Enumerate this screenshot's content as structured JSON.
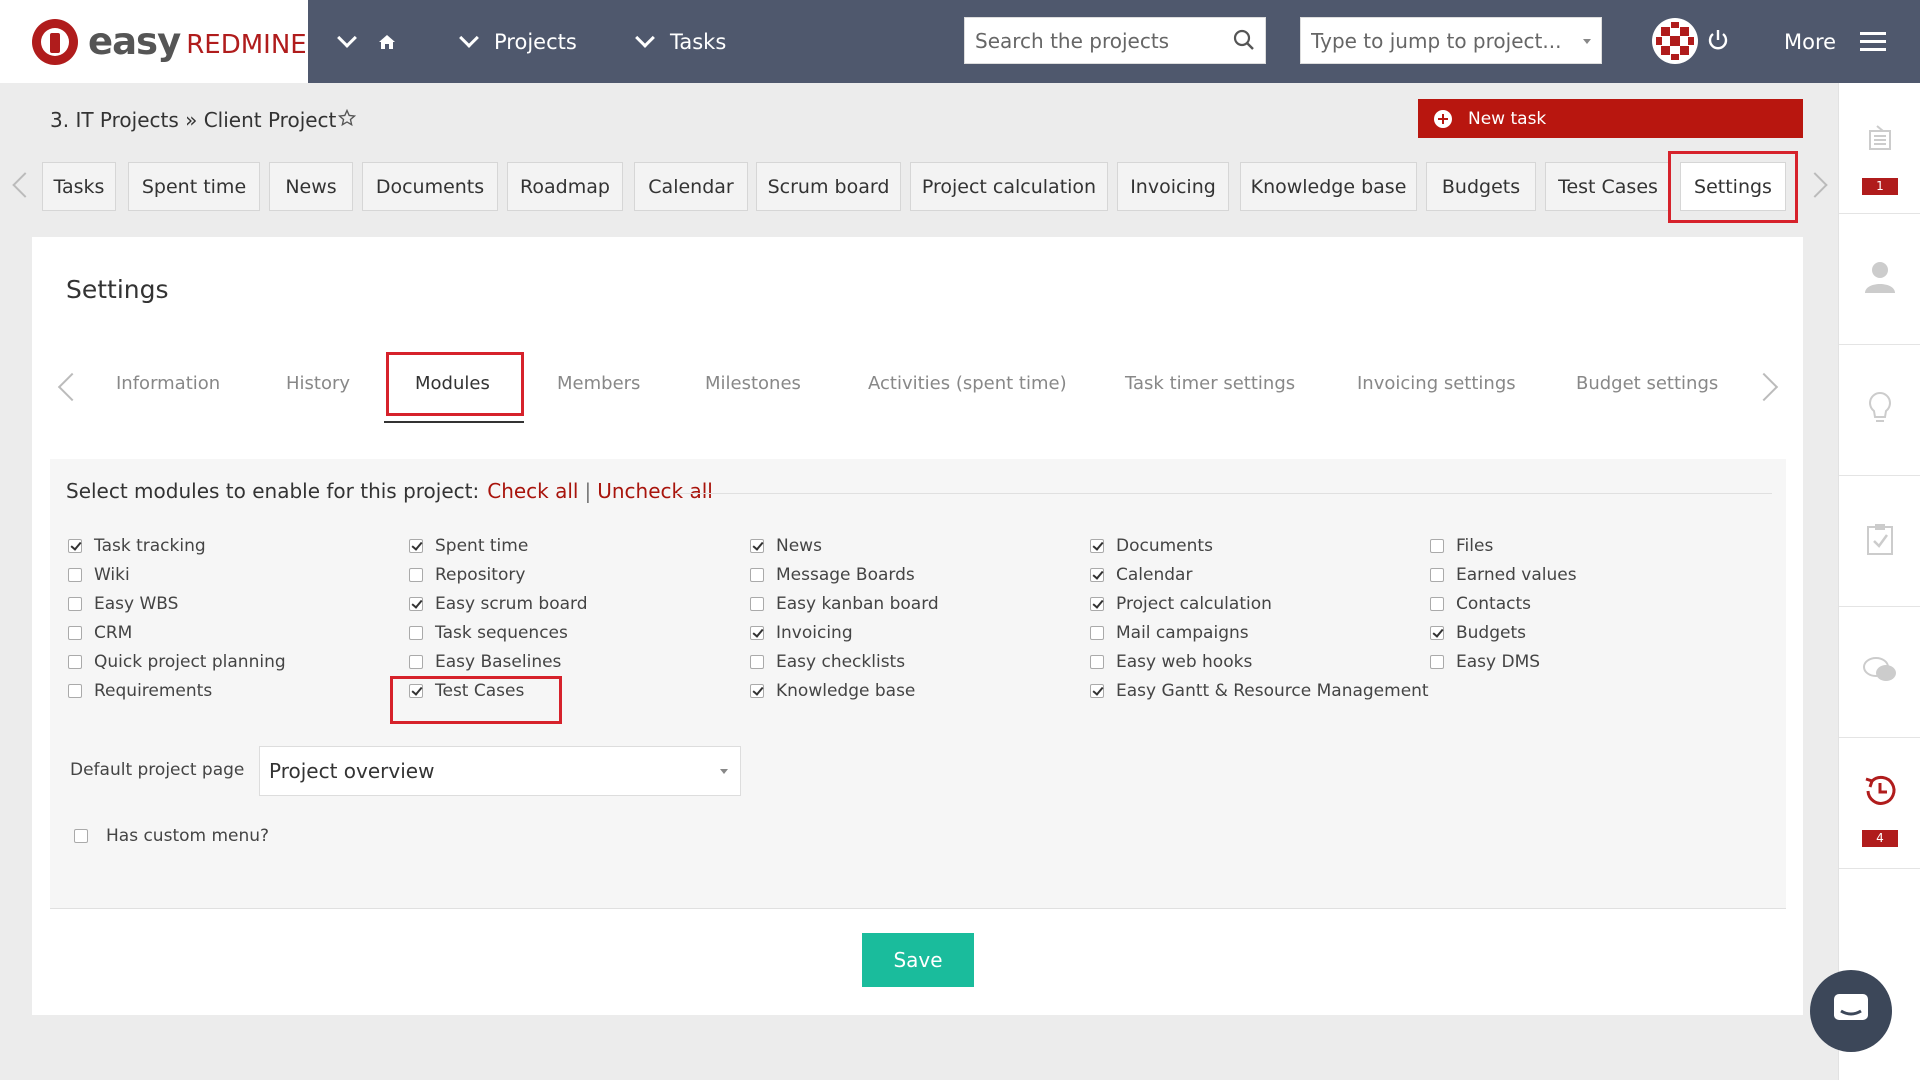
{
  "brand": {
    "easy": "easy",
    "redmine": "REDMINE"
  },
  "topnav": {
    "projects_label": "Projects",
    "tasks_label": "Tasks",
    "search_placeholder": "Search the projects",
    "jump_placeholder": "Type to jump to project...",
    "more_label": "More"
  },
  "breadcrumb": {
    "text": "3. IT Projects » Client Project"
  },
  "new_task_label": "New task",
  "project_tabs": [
    "Tasks",
    "Spent time",
    "News",
    "Documents",
    "Roadmap",
    "Calendar",
    "Scrum board",
    "Project calculation",
    "Invoicing",
    "Knowledge base",
    "Budgets",
    "Test Cases",
    "Settings"
  ],
  "active_project_tab": "Settings",
  "settings": {
    "title": "Settings",
    "tabs": [
      "Information",
      "History",
      "Modules",
      "Members",
      "Milestones",
      "Activities (spent time)",
      "Task timer settings",
      "Invoicing settings",
      "Budget settings"
    ],
    "active_tab": "Modules"
  },
  "modules": {
    "heading": "Select modules to enable for this project:",
    "check_all": "Check all",
    "separator": "|",
    "uncheck_all": "Uncheck all",
    "columns": [
      [
        {
          "label": "Task tracking",
          "checked": true
        },
        {
          "label": "Wiki",
          "checked": false
        },
        {
          "label": "Easy WBS",
          "checked": false
        },
        {
          "label": "CRM",
          "checked": false
        },
        {
          "label": "Quick project planning",
          "checked": false
        },
        {
          "label": "Requirements",
          "checked": false
        }
      ],
      [
        {
          "label": "Spent time",
          "checked": true
        },
        {
          "label": "Repository",
          "checked": false
        },
        {
          "label": "Easy scrum board",
          "checked": true
        },
        {
          "label": "Task sequences",
          "checked": false
        },
        {
          "label": "Easy Baselines",
          "checked": false
        },
        {
          "label": "Test Cases",
          "checked": true
        }
      ],
      [
        {
          "label": "News",
          "checked": true
        },
        {
          "label": "Message Boards",
          "checked": false
        },
        {
          "label": "Easy kanban board",
          "checked": false
        },
        {
          "label": "Invoicing",
          "checked": true
        },
        {
          "label": "Easy checklists",
          "checked": false
        },
        {
          "label": "Knowledge base",
          "checked": true
        }
      ],
      [
        {
          "label": "Documents",
          "checked": true
        },
        {
          "label": "Calendar",
          "checked": true
        },
        {
          "label": "Project calculation",
          "checked": true
        },
        {
          "label": "Mail campaigns",
          "checked": false
        },
        {
          "label": "Easy web hooks",
          "checked": false
        },
        {
          "label": "Easy Gantt & Resource Management",
          "checked": true
        }
      ],
      [
        {
          "label": "Files",
          "checked": false
        },
        {
          "label": "Earned values",
          "checked": false
        },
        {
          "label": "Contacts",
          "checked": false
        },
        {
          "label": "Budgets",
          "checked": true
        },
        {
          "label": "Easy DMS",
          "checked": false
        }
      ]
    ]
  },
  "default_page": {
    "label": "Default project page",
    "value": "Project overview"
  },
  "custom_menu": {
    "label": "Has custom menu?",
    "checked": false
  },
  "save_label": "Save",
  "sidebar": {
    "badge_tasks": "1",
    "badge_history": "4"
  },
  "colors": {
    "topbar": "#4f586d",
    "accent_red": "#b8160f",
    "save_green": "#1abc9c",
    "highlight": "#d6222b"
  }
}
